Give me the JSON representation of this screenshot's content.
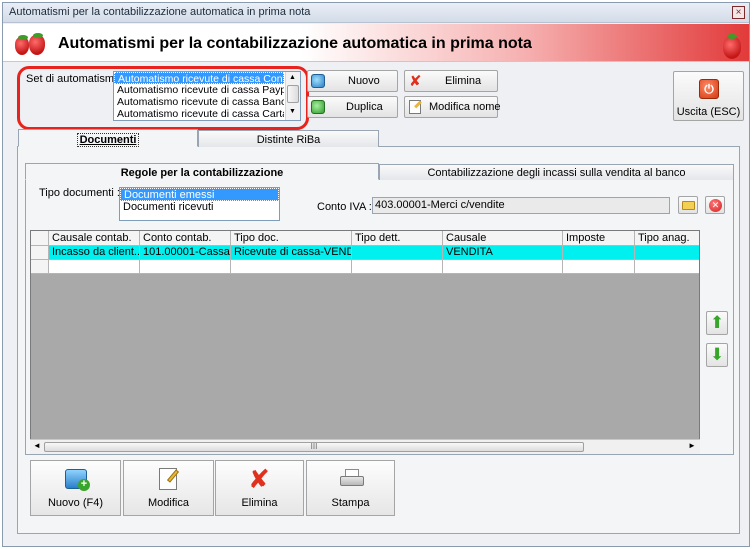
{
  "window": {
    "title": "Automatismi per la contabilizzazione automatica in prima nota",
    "close_glyph": "×"
  },
  "banner": {
    "heading": "Automatismi per la contabilizzazione automatica in prima nota"
  },
  "set": {
    "label": "Set di automatismi :",
    "items": [
      "Automatismo ricevute di cassa Contanti",
      "Automatismo ricevute di cassa Paypal",
      "Automatismo ricevute di cassa Bancomat",
      "Automatismo ricevute di cassa Carta di credito"
    ],
    "selected_index": 0
  },
  "toolbar": {
    "nuovo": "Nuovo",
    "duplica": "Duplica",
    "elimina": "Elimina",
    "modifica_nome": "Modifica nome",
    "uscita": "Uscita (ESC)"
  },
  "outer_tabs": [
    {
      "label": "Documenti",
      "active": true
    },
    {
      "label": "Distinte RiBa",
      "active": false
    }
  ],
  "inner_tabs": [
    {
      "label": "Regole per la contabilizzazione",
      "active": true
    },
    {
      "label": "Contabilizzazione degli incassi sulla vendita al banco",
      "active": false
    }
  ],
  "tipo_documenti": {
    "label": "Tipo documenti :",
    "items": [
      "Documenti emessi",
      "Documenti ricevuti"
    ],
    "selected_index": 0
  },
  "conto_iva": {
    "label": "Conto IVA :",
    "value": "403.00001-Merci c/vendite"
  },
  "grid": {
    "columns": [
      "Causale contab.",
      "Conto contab.",
      "Tipo doc.",
      "Tipo dett.",
      "Causale",
      "Imposte",
      "Tipo anag."
    ],
    "rows": [
      [
        "Incasso da client...",
        "101.00001-Cassa",
        "Ricevute di cassa-VEND...",
        "",
        "VENDITA",
        "",
        ""
      ]
    ],
    "scroll_glyph": "III"
  },
  "bottom": {
    "nuovo": "Nuovo (F4)",
    "modifica": "Modifica",
    "elimina": "Elimina",
    "stampa": "Stampa"
  },
  "colors": {
    "selection": "#3399ff",
    "row_highlight": "#00f0f0",
    "annotation": "#e8231d"
  }
}
